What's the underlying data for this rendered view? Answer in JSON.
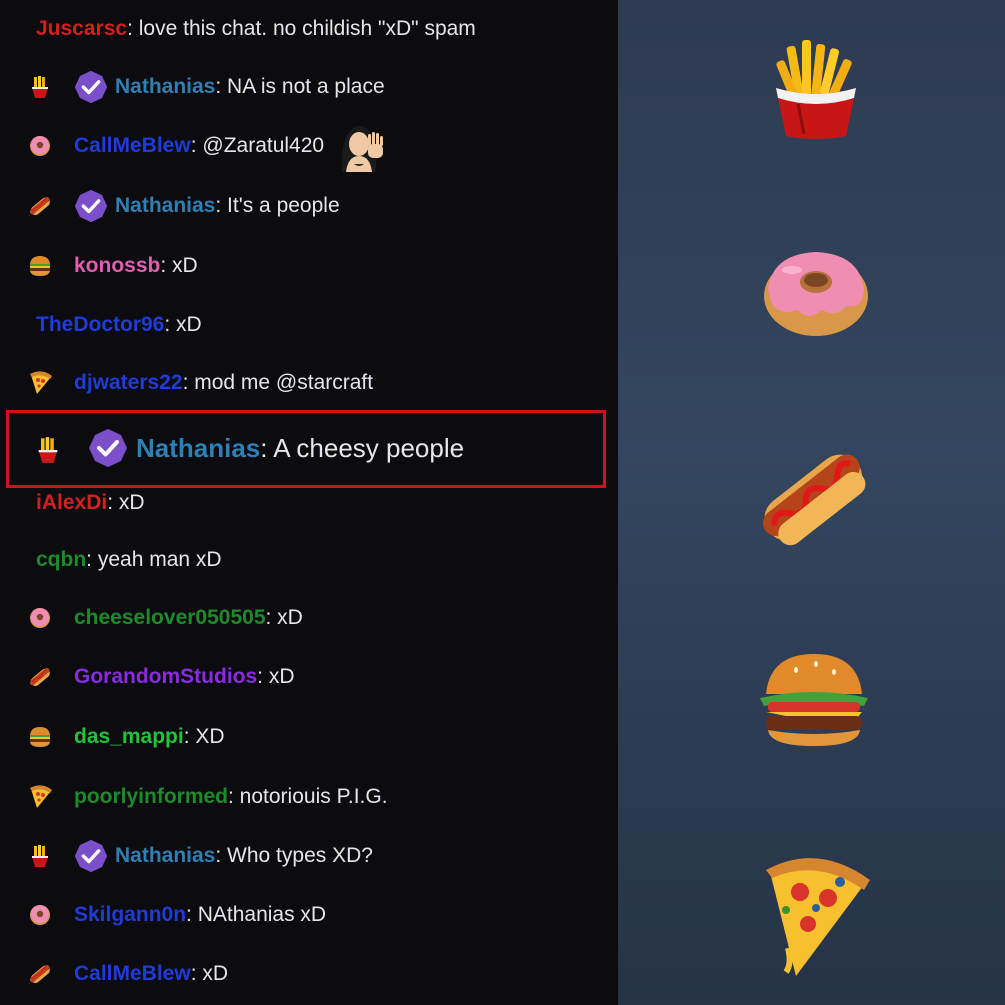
{
  "chat": {
    "messages": [
      {
        "badge": "none",
        "verified": false,
        "name": "Juscarsc",
        "color": "#d51f1f",
        "text": ": love this chat. no childish \"xD\" spam"
      },
      {
        "badge": "fries-icon",
        "verified": true,
        "name": "Nathanias",
        "color": "#2e7fb3",
        "text": ": NA is not a place"
      },
      {
        "badge": "donut-icon",
        "verified": false,
        "name": "CallMeBlew",
        "color": "#1f3bd8",
        "text": ": @Zaratul420",
        "emote": "waving-woman-emote"
      },
      {
        "badge": "hotdog-icon",
        "verified": true,
        "name": "Nathanias",
        "color": "#2e7fb3",
        "text": ": It's a people"
      },
      {
        "badge": "burger-icon",
        "verified": false,
        "name": "konossb",
        "color": "#e05fb0",
        "text": ": xD"
      },
      {
        "badge": "none",
        "verified": false,
        "name": "TheDoctor96",
        "color": "#1f3bd8",
        "text": ": xD"
      },
      {
        "badge": "pizza-icon",
        "verified": false,
        "name": "djwaters22",
        "color": "#1f3bd8",
        "text": ": mod me @starcraft"
      },
      {
        "badge": "fries-icon",
        "verified": true,
        "name": "Nathanias",
        "color": "#2e7fb3",
        "text": ": A cheesy people",
        "highlighted": true
      },
      {
        "badge": "none",
        "verified": false,
        "name": "iAlexDi",
        "color": "#d51f1f",
        "text": ": xD"
      },
      {
        "badge": "none",
        "verified": false,
        "name": "cqbn",
        "color": "#1f8a2a",
        "text": ": yeah man xD"
      },
      {
        "badge": "donut-icon",
        "verified": false,
        "name": "cheeselover050505",
        "color": "#1f8a2a",
        "text": ": xD"
      },
      {
        "badge": "hotdog-icon",
        "verified": false,
        "name": "GorandomStudios",
        "color": "#8a2be2",
        "text": ": xD"
      },
      {
        "badge": "burger-icon",
        "verified": false,
        "name": "das_mappi",
        "color": "#23c23a",
        "text": ": XD"
      },
      {
        "badge": "pizza-icon",
        "verified": false,
        "name": "poorlyinformed",
        "color": "#1f8a2a",
        "text": ": notoriouis P.I.G."
      },
      {
        "badge": "fries-icon",
        "verified": true,
        "name": "Nathanias",
        "color": "#2e7fb3",
        "text": ": Who types XD?"
      },
      {
        "badge": "donut-icon",
        "verified": false,
        "name": "Skilgann0n",
        "color": "#1f3bd8",
        "text": ": NAthanias xD"
      },
      {
        "badge": "hotdog-icon",
        "verified": false,
        "name": "CallMeBlew",
        "color": "#1f3bd8",
        "text": ": xD"
      }
    ]
  },
  "sidebar": {
    "icons": [
      "fries-icon",
      "donut-icon",
      "hotdog-icon",
      "burger-icon",
      "pizza-icon"
    ]
  },
  "colors": {
    "highlight_border": "#d0121b",
    "verified_badge": "#7b4fc9",
    "chat_background": "#0c0b10",
    "sidebar_background": "#2e3b52"
  }
}
